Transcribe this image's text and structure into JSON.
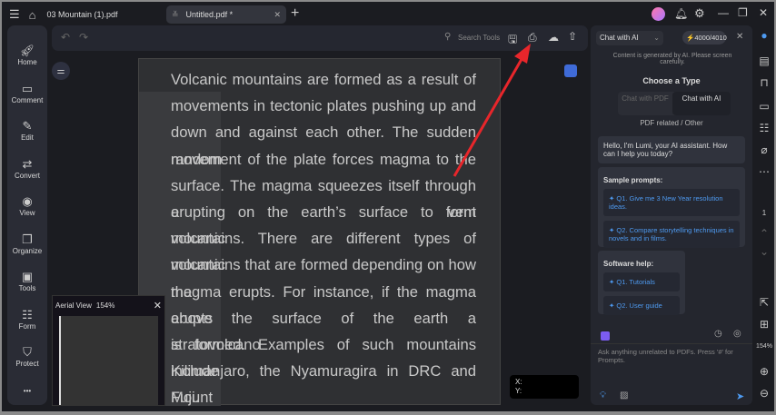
{
  "titlebar": {
    "file_name": "03 Mountain (1).pdf",
    "tab_label": "Untitled.pdf *"
  },
  "sidebar": {
    "items": [
      {
        "label": "Home",
        "icon": "rocket-icon"
      },
      {
        "label": "Comment",
        "icon": "comment-icon"
      },
      {
        "label": "Edit",
        "icon": "edit-icon"
      },
      {
        "label": "Convert",
        "icon": "convert-icon"
      },
      {
        "label": "View",
        "icon": "eye-icon"
      },
      {
        "label": "Organize",
        "icon": "organize-icon"
      },
      {
        "label": "Tools",
        "icon": "toolbox-icon"
      },
      {
        "label": "Form",
        "icon": "form-icon"
      },
      {
        "label": "Protect",
        "icon": "shield-icon"
      }
    ],
    "more": "•••"
  },
  "toolbar": {
    "search_placeholder": "Search Tools"
  },
  "document": {
    "lines": [
      "Volcanic mountains are formed as a result of",
      "movements in tectonic plates pushing up and",
      "down and against each other. The sudden random",
      "movement of the plate forces magma to the",
      "surface. The magma squeezes itself through a vent",
      "erupting on the earth’s surface to form volcanic",
      "mountains. There are different types of volcanic",
      "mountains that are formed depending on how the",
      "magma erupts. For instance, if the magma erupts",
      "above the surface of the earth a stratovolcano",
      "is formed. Examples of such mountains include",
      "Kilimanjaro, the Nyamuragira in DRC and Mount",
      "Fuji."
    ]
  },
  "aerial": {
    "title": "Aerial View",
    "zoom": "154%"
  },
  "coords": {
    "x": "X:",
    "y": "Y:"
  },
  "chat": {
    "mode": "Chat with AI",
    "credits": "4000/4010",
    "disclaimer": "Content is generated by AI. Please screen carefully.",
    "choose_type": "Choose a Type",
    "type_pdf": "Chat with PDF",
    "type_ai": "Chat with AI",
    "type_caption": "PDF related / Other",
    "greeting": "Hello, I'm Lumi, your AI assistant. How can I help you today?",
    "sample_title": "Sample prompts:",
    "samples": [
      "Q1. Give me 3 New Year resolution ideas.",
      "Q2. Compare storytelling techniques in novels and in films."
    ],
    "help_title": "Software help:",
    "help": [
      "Q1. Tutorials",
      "Q2. User guide"
    ],
    "input_placeholder": "Ask anything unrelated to PDFs. Press '#' for Prompts."
  },
  "rail": {
    "page": "1",
    "zoom": "154%"
  },
  "colors": {
    "accent": "#4e9af0",
    "arrow": "#e8262b"
  }
}
